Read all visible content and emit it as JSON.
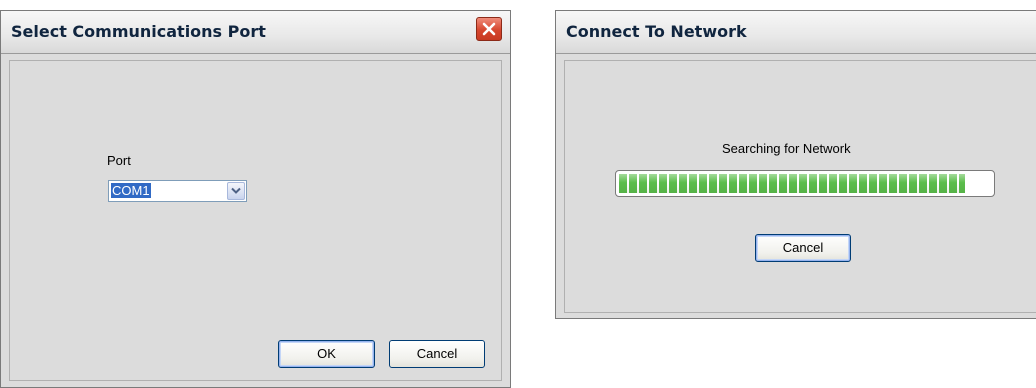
{
  "select_port_dialog": {
    "title": "Select Communications Port",
    "port_label": "Port",
    "port_select_value": "COM1",
    "ok_label": "OK",
    "cancel_label": "Cancel"
  },
  "network_dialog": {
    "title": "Connect To Network",
    "status_text": "Searching for Network",
    "progress_fraction": 0.93,
    "cancel_label": "Cancel"
  },
  "colors": {
    "progress_green": "#5bbd4b",
    "close_red": "#d6462e",
    "dialog_bg": "#dcdcdc"
  },
  "icons": {
    "close": "close-icon",
    "dropdown": "chevron-down-icon"
  }
}
